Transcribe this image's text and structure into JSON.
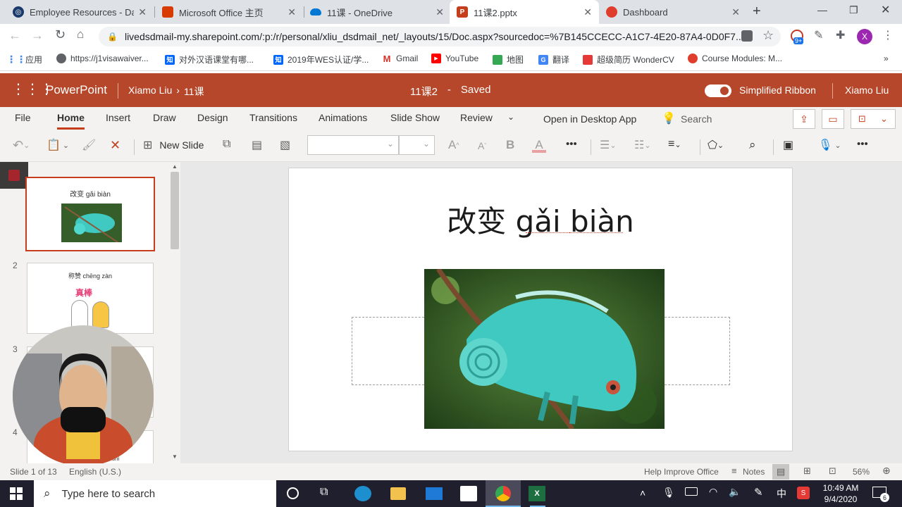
{
  "browser": {
    "tabs": [
      {
        "title": "Employee Resources - Davis",
        "icon": "globe-icon",
        "color": "#1a3a6b"
      },
      {
        "title": "Microsoft Office 主页",
        "icon": "office-icon",
        "color": "#d83b01"
      },
      {
        "title": "11课 - OneDrive",
        "icon": "onedrive-icon",
        "color": "#0078d4"
      },
      {
        "title": "11课2.pptx",
        "icon": "powerpoint-icon",
        "color": "#c43e1c"
      },
      {
        "title": "Dashboard",
        "icon": "dashboard-icon",
        "color": "#e03e2d"
      }
    ],
    "url": "livedsdmail-my.sharepoint.com/:p:/r/personal/xliu_dsdmail_net/_layouts/15/Doc.aspx?sourcedoc=%7B145CCECC-A1C7-4E20-87A4-0D0F7...",
    "profile_initial": "X",
    "extension_badge": "9+",
    "bookmarks": [
      {
        "label": "应用",
        "icon": "apps-grid-icon",
        "color": "#4285f4"
      },
      {
        "label": "https://j1visawaiver...",
        "icon": "globe-icon",
        "color": "#5f6368"
      },
      {
        "label": "对外汉语课堂有哪...",
        "icon": "zhihu-icon",
        "color": "#0066ff"
      },
      {
        "label": "2019年WES认证/学...",
        "icon": "zhihu-icon",
        "color": "#0066ff"
      },
      {
        "label": "Gmail",
        "icon": "gmail-icon",
        "color": "#d93025"
      },
      {
        "label": "YouTube",
        "icon": "youtube-icon",
        "color": "#ff0000"
      },
      {
        "label": "地图",
        "icon": "maps-icon",
        "color": "#34a853"
      },
      {
        "label": "翻译",
        "icon": "translate-icon",
        "color": "#4285f4"
      },
      {
        "label": "超级简历 WonderCV",
        "icon": "wondercv-icon",
        "color": "#e53935"
      },
      {
        "label": "Course Modules: M...",
        "icon": "canvas-icon",
        "color": "#e03e2d"
      }
    ],
    "bookmarks_more": "»"
  },
  "ppt": {
    "app_name": "PowerPoint",
    "breadcrumb_owner": "Xiamo Liu",
    "breadcrumb_sep": "›",
    "breadcrumb_folder": "11课",
    "doc_title": "11课2",
    "doc_status_sep": "-",
    "doc_status": "Saved",
    "simplified_ribbon_label": "Simplified Ribbon",
    "user_name": "Xiamo Liu",
    "menu_tabs": [
      "File",
      "Home",
      "Insert",
      "Draw",
      "Design",
      "Transitions",
      "Animations",
      "Slide Show",
      "Review"
    ],
    "active_menu": "Home",
    "open_desktop": "Open in Desktop App",
    "search_label": "Search",
    "new_slide_label": "New Slide",
    "font_size_up": "A",
    "font_size_down": "A",
    "bold_label": "B",
    "font_color_label": "A",
    "more_label": "•••"
  },
  "slides": {
    "numbers": [
      "2",
      "3",
      "4"
    ],
    "thumb1_title": "改变 gǎi biàn",
    "thumb2_title": "称赞 chēng zàn",
    "thumb2_badge": "真棒",
    "thumb4_partial": "shi"
  },
  "slide_main": {
    "title": "改变 gǎi biàn",
    "image_desc": "chameleon"
  },
  "status": {
    "slide_info": "Slide 1 of 13",
    "language": "English (U.S.)",
    "help": "Help Improve Office",
    "notes": "Notes",
    "zoom": "56%"
  },
  "taskbar": {
    "search_placeholder": "Type here to search",
    "time": "10:49 AM",
    "date": "9/4/2020",
    "ime": "中",
    "notif_count": "6"
  },
  "colors": {
    "ppt_red": "#b7472a",
    "accent_red": "#c43e1c"
  }
}
